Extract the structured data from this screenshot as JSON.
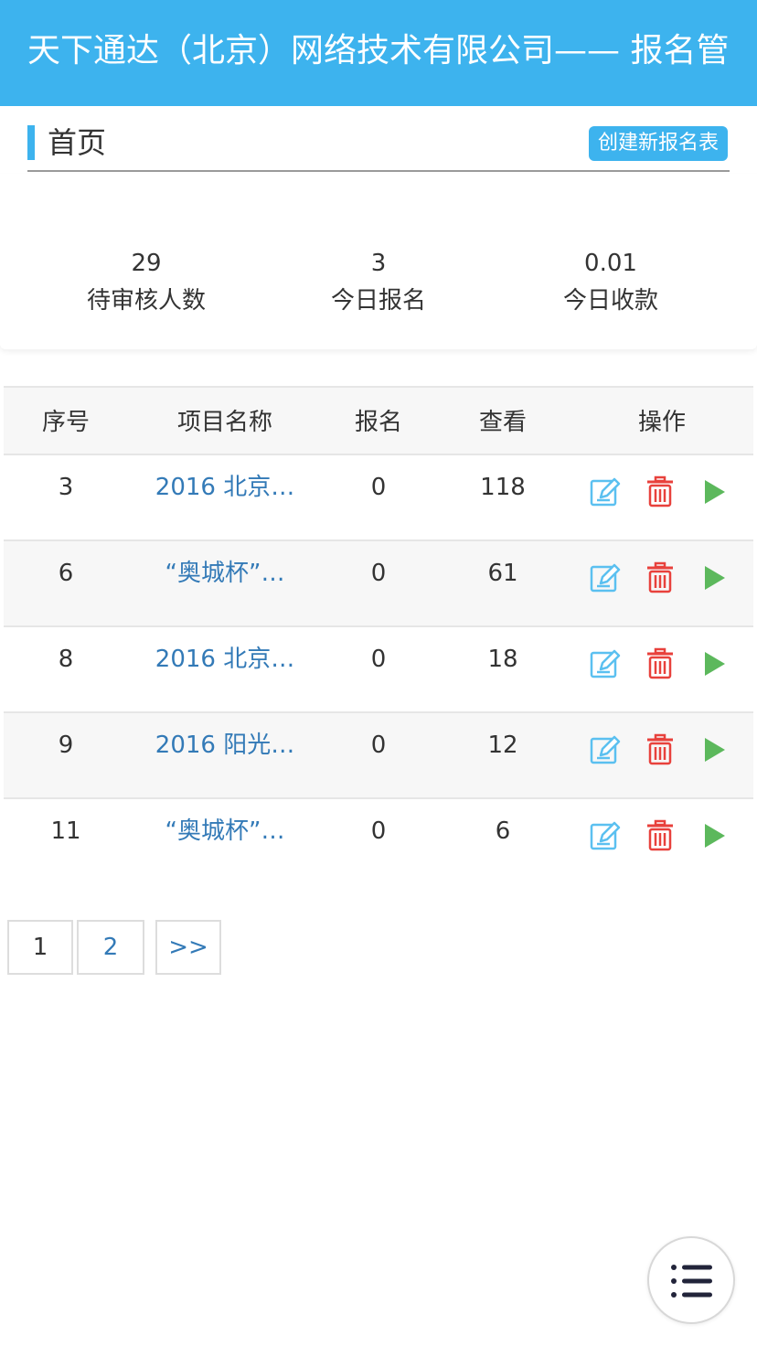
{
  "header": {
    "title": "天下通达（北京）网络技术有限公司—— 报名管"
  },
  "section": {
    "title": "首页",
    "create_button": "创建新报名表"
  },
  "stats": [
    {
      "value": "29",
      "label": "待审核人数"
    },
    {
      "value": "3",
      "label": "今日报名"
    },
    {
      "value": "0.01",
      "label": "今日收款"
    }
  ],
  "table": {
    "headers": [
      "序号",
      "项目名称",
      "报名",
      "查看",
      "操作"
    ],
    "rows": [
      {
        "id": "3",
        "name": "2016 北京…",
        "signups": "0",
        "views": "118"
      },
      {
        "id": "6",
        "name": "“奥城杯”…",
        "signups": "0",
        "views": "61"
      },
      {
        "id": "8",
        "name": "2016 北京…",
        "signups": "0",
        "views": "18"
      },
      {
        "id": "9",
        "name": "2016 阳光…",
        "signups": "0",
        "views": "12"
      },
      {
        "id": "11",
        "name": "“奥城杯”…",
        "signups": "0",
        "views": "6"
      }
    ],
    "action_icons": [
      "edit-icon",
      "trash-icon",
      "play-icon"
    ]
  },
  "pagination": {
    "pages": [
      "1",
      "2"
    ],
    "next": ">>",
    "current": "1"
  },
  "fab": {
    "icon": "list-menu-icon"
  },
  "colors": {
    "primary": "#3db3ee",
    "link": "#337ab7",
    "edit": "#5bc0f0",
    "delete": "#e8413c",
    "play": "#5cb85c"
  }
}
